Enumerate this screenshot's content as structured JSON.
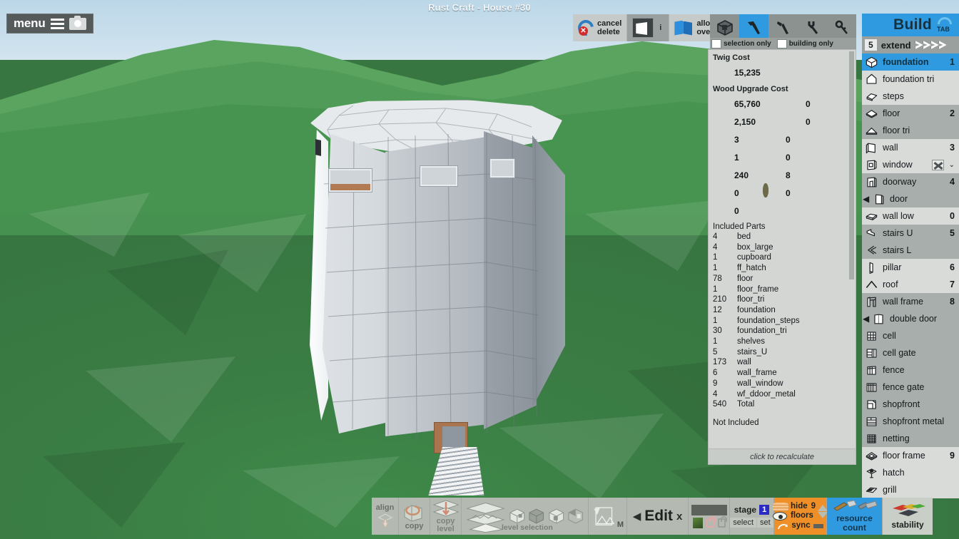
{
  "window": {
    "title": "Rust Craft - House #30"
  },
  "menu": {
    "label": "menu",
    "hamburger_icon": "hamburger-icon",
    "camera_icon": "camera-icon"
  },
  "top_tools": {
    "cancel_delete": "cancel\ndelete",
    "cancel_label_line1": "cancel",
    "cancel_label_line2": "delete",
    "info": "i",
    "allow_overlap_line1": "allow",
    "allow_overlap_line2": "overlap"
  },
  "tool_strip": {
    "buttons": [
      {
        "name": "block-tool",
        "active": false
      },
      {
        "name": "hammer-tool",
        "active": true
      },
      {
        "name": "pickaxe-tool",
        "active": false
      },
      {
        "name": "wrench-tool",
        "active": false
      },
      {
        "name": "key-tool",
        "active": false
      }
    ],
    "selection_only": "selection only",
    "building_only": "building only"
  },
  "cost_panel": {
    "twig_cost_title": "Twig Cost",
    "twig": [
      {
        "icon": "wood-icon",
        "value": "15,235"
      }
    ],
    "wood_upgrade_title": "Wood Upgrade Cost",
    "resources": [
      {
        "icon": "wood-icon",
        "value": "65,760"
      },
      {
        "icon": "stone-icon",
        "value": "0"
      },
      {
        "icon": "metal-frag-icon",
        "value": "2,150"
      },
      {
        "icon": "hqm-icon",
        "value": "0"
      },
      {
        "icon": "gear-icon",
        "value": "3"
      },
      {
        "icon": "tarp-icon",
        "value": "0"
      },
      {
        "icon": "rebar-icon",
        "value": "1"
      },
      {
        "icon": "cloth-icon",
        "value": "0"
      },
      {
        "icon": "leather-icon",
        "value": "240"
      },
      {
        "icon": "barrel-icon",
        "value": "8"
      },
      {
        "icon": "ore-icon",
        "value": "0"
      },
      {
        "icon": "rope-icon",
        "value": "0"
      },
      {
        "icon": "pig-skin-icon",
        "value": "0"
      }
    ],
    "included_title": "Included Parts",
    "parts": [
      {
        "count": "4",
        "name": "bed"
      },
      {
        "count": "4",
        "name": "box_large"
      },
      {
        "count": "1",
        "name": "cupboard"
      },
      {
        "count": "1",
        "name": "ff_hatch"
      },
      {
        "count": "78",
        "name": "floor"
      },
      {
        "count": "1",
        "name": "floor_frame"
      },
      {
        "count": "210",
        "name": "floor_tri"
      },
      {
        "count": "12",
        "name": "foundation"
      },
      {
        "count": "1",
        "name": "foundation_steps"
      },
      {
        "count": "30",
        "name": "foundation_tri"
      },
      {
        "count": "1",
        "name": "shelves"
      },
      {
        "count": "5",
        "name": "stairs_U"
      },
      {
        "count": "173",
        "name": "wall"
      },
      {
        "count": "6",
        "name": "wall_frame"
      },
      {
        "count": "9",
        "name": "wall_window"
      },
      {
        "count": "4",
        "name": "wf_ddoor_metal"
      },
      {
        "count": "540",
        "name": "Total"
      }
    ],
    "not_included_title": "Not Included",
    "recalculate": "click to recalculate"
  },
  "build_panel": {
    "title": "Build",
    "tab_hint": "TAB",
    "extend": {
      "count": "5",
      "label": "extend"
    },
    "items": [
      {
        "label": "foundation",
        "hotkey": "1",
        "icon": "foundation-icon",
        "selected": true,
        "shade": "sel"
      },
      {
        "label": "foundation tri",
        "hotkey": "",
        "icon": "foundation-tri-icon",
        "selected": false,
        "shade": "lite"
      },
      {
        "label": "steps",
        "hotkey": "",
        "icon": "steps-icon",
        "selected": false,
        "shade": "lite"
      },
      {
        "label": "floor",
        "hotkey": "2",
        "icon": "floor-icon",
        "selected": false,
        "shade": "dark"
      },
      {
        "label": "floor tri",
        "hotkey": "",
        "icon": "floor-tri-icon",
        "selected": false,
        "shade": "dark"
      },
      {
        "label": "wall",
        "hotkey": "3",
        "icon": "wall-icon",
        "selected": false,
        "shade": "lite"
      },
      {
        "label": "window",
        "hotkey": "",
        "icon": "window-icon",
        "selected": false,
        "shade": "lite",
        "badge": "window-variant-badge",
        "chevron": "chevron-down-icon"
      },
      {
        "label": "doorway",
        "hotkey": "4",
        "icon": "doorway-icon",
        "selected": false,
        "shade": "dark"
      },
      {
        "label": "door",
        "hotkey": "",
        "icon": "door-icon",
        "selected": false,
        "shade": "dark",
        "prefix": "◀"
      },
      {
        "label": "wall low",
        "hotkey": "0",
        "icon": "wall-low-icon",
        "selected": false,
        "shade": "lite"
      },
      {
        "label": "stairs U",
        "hotkey": "5",
        "icon": "stairs-u-icon",
        "selected": false,
        "shade": "dark"
      },
      {
        "label": "stairs L",
        "hotkey": "",
        "icon": "stairs-l-icon",
        "selected": false,
        "shade": "dark"
      },
      {
        "label": "pillar",
        "hotkey": "6",
        "icon": "pillar-icon",
        "selected": false,
        "shade": "lite"
      },
      {
        "label": "roof",
        "hotkey": "7",
        "icon": "roof-icon",
        "selected": false,
        "shade": "lite"
      },
      {
        "label": "wall frame",
        "hotkey": "8",
        "icon": "wall-frame-icon",
        "selected": false,
        "shade": "dark"
      },
      {
        "label": "double door",
        "hotkey": "",
        "icon": "double-door-icon",
        "selected": false,
        "shade": "dark",
        "prefix": "◀"
      },
      {
        "label": "cell",
        "hotkey": "",
        "icon": "cell-icon",
        "selected": false,
        "shade": "dark"
      },
      {
        "label": "cell gate",
        "hotkey": "",
        "icon": "cell-gate-icon",
        "selected": false,
        "shade": "dark"
      },
      {
        "label": "fence",
        "hotkey": "",
        "icon": "fence-icon",
        "selected": false,
        "shade": "dark"
      },
      {
        "label": "fence gate",
        "hotkey": "",
        "icon": "fence-gate-icon",
        "selected": false,
        "shade": "dark"
      },
      {
        "label": "shopfront",
        "hotkey": "",
        "icon": "shopfront-icon",
        "selected": false,
        "shade": "dark"
      },
      {
        "label": "shopfront metal",
        "hotkey": "",
        "icon": "shopfront-metal-icon",
        "selected": false,
        "shade": "dark"
      },
      {
        "label": "netting",
        "hotkey": "",
        "icon": "netting-icon",
        "selected": false,
        "shade": "dark"
      },
      {
        "label": "floor frame",
        "hotkey": "9",
        "icon": "floor-frame-icon",
        "selected": false,
        "shade": "lite"
      },
      {
        "label": "hatch",
        "hotkey": "",
        "icon": "hatch-icon",
        "selected": false,
        "shade": "lite"
      },
      {
        "label": "grill",
        "hotkey": "",
        "icon": "grill-icon",
        "selected": false,
        "shade": "lite"
      }
    ]
  },
  "bottom_bar": {
    "align": "align",
    "copy": "copy",
    "copy_level_line1": "copy",
    "copy_level_line2": "level",
    "level_selection": "level selection",
    "m_label": "M",
    "edit": "Edit",
    "edit_close": "x",
    "stage": "stage",
    "stage_value": "1",
    "select": "select",
    "set": "set",
    "hide": "hide",
    "hide_count": "9",
    "floors": "floors",
    "sync": "sync",
    "resource_line1": "resource",
    "resource_line2": "count",
    "stability": "stability"
  },
  "colors": {
    "accent_blue": "#2f9ae0",
    "orange": "#ef8f28",
    "panel_gray": "#d3d6d3",
    "toolbar_gray": "#b4b9b2",
    "terrain_green": "#3f8149",
    "sky": "#cfe2ee"
  }
}
